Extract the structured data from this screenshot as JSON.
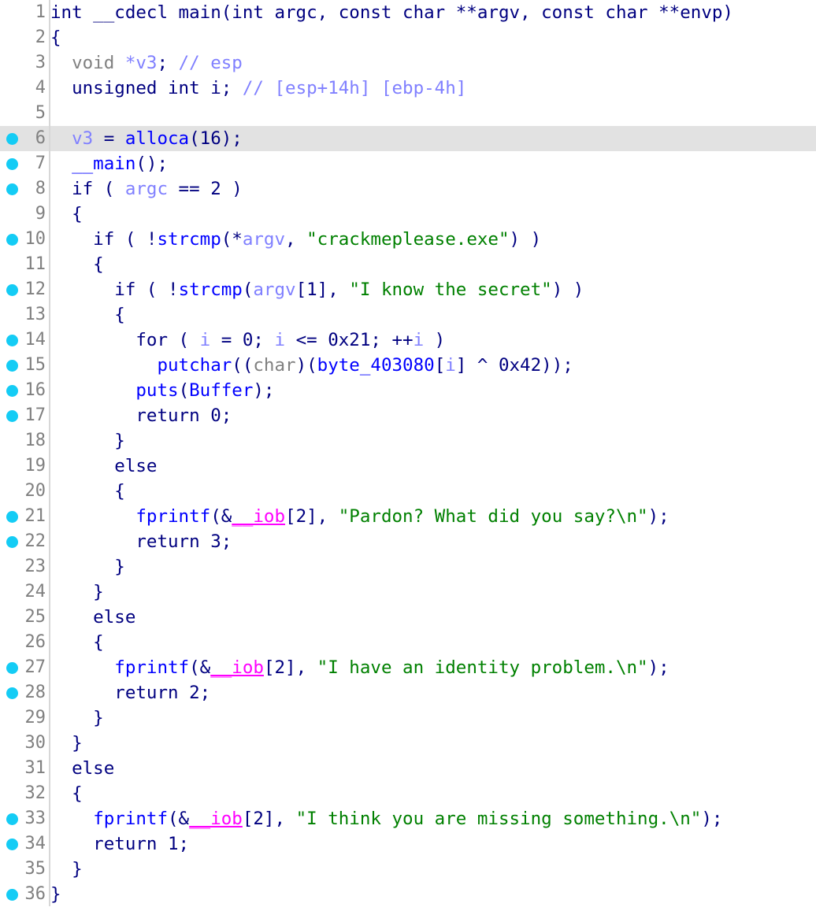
{
  "view": {
    "name": "pseudocode-view",
    "app": "IDA Pro Pseudocode",
    "highlighted_line": 6,
    "colors": {
      "background": "#ffffff",
      "highlight_row": "#e2e2e2",
      "gutter_divider": "#d7d7d7",
      "line_number": "#808080",
      "breakpoint_dot": "#14ccf5",
      "keyword": "#000080",
      "type": "#808080",
      "local_variable": "#8080ff",
      "function": "#0000ff",
      "string": "#008000",
      "comment": "#8080ff",
      "imported_variable": "#ff00ff"
    }
  },
  "lines": [
    {
      "n": "1",
      "bp": false,
      "tokens": [
        {
          "t": "int __cdecl main(int argc, const char **argv, const char **envp)",
          "c": "t-key"
        }
      ]
    },
    {
      "n": "2",
      "bp": false,
      "tokens": [
        {
          "t": "{",
          "c": "t-punct"
        }
      ]
    },
    {
      "n": "3",
      "bp": false,
      "tokens": [
        {
          "t": "  ",
          "c": "t-plain"
        },
        {
          "t": "void",
          "c": "t-type"
        },
        {
          "t": " ",
          "c": "t-plain"
        },
        {
          "t": "*v3",
          "c": "t-lvar"
        },
        {
          "t": "; ",
          "c": "t-punct"
        },
        {
          "t": "// esp",
          "c": "t-cmt"
        }
      ]
    },
    {
      "n": "4",
      "bp": false,
      "tokens": [
        {
          "t": "  unsigned int i",
          "c": "t-key"
        },
        {
          "t": "; ",
          "c": "t-punct"
        },
        {
          "t": "// [esp+14h] [ebp-4h]",
          "c": "t-cmt"
        }
      ]
    },
    {
      "n": "5",
      "bp": false,
      "tokens": []
    },
    {
      "n": "6",
      "bp": true,
      "tokens": [
        {
          "t": "  ",
          "c": "t-plain"
        },
        {
          "t": "v3",
          "c": "t-lvar"
        },
        {
          "t": " = ",
          "c": "t-punct"
        },
        {
          "t": "alloca",
          "c": "t-func"
        },
        {
          "t": "(16);",
          "c": "t-punct"
        }
      ]
    },
    {
      "n": "7",
      "bp": true,
      "tokens": [
        {
          "t": "  ",
          "c": "t-plain"
        },
        {
          "t": "__main",
          "c": "t-func"
        },
        {
          "t": "();",
          "c": "t-punct"
        }
      ]
    },
    {
      "n": "8",
      "bp": true,
      "tokens": [
        {
          "t": "  if ( ",
          "c": "t-key"
        },
        {
          "t": "argc",
          "c": "t-lvar"
        },
        {
          "t": " == 2 )",
          "c": "t-punct"
        }
      ]
    },
    {
      "n": "9",
      "bp": false,
      "tokens": [
        {
          "t": "  {",
          "c": "t-punct"
        }
      ]
    },
    {
      "n": "10",
      "bp": true,
      "tokens": [
        {
          "t": "    if ( !",
          "c": "t-key"
        },
        {
          "t": "strcmp",
          "c": "t-func"
        },
        {
          "t": "(*",
          "c": "t-punct"
        },
        {
          "t": "argv",
          "c": "t-lvar"
        },
        {
          "t": ", ",
          "c": "t-punct"
        },
        {
          "t": "\"crackmeplease.exe\"",
          "c": "t-str"
        },
        {
          "t": ") )",
          "c": "t-punct"
        }
      ]
    },
    {
      "n": "11",
      "bp": false,
      "tokens": [
        {
          "t": "    {",
          "c": "t-punct"
        }
      ]
    },
    {
      "n": "12",
      "bp": true,
      "tokens": [
        {
          "t": "      if ( !",
          "c": "t-key"
        },
        {
          "t": "strcmp",
          "c": "t-func"
        },
        {
          "t": "(",
          "c": "t-punct"
        },
        {
          "t": "argv",
          "c": "t-lvar"
        },
        {
          "t": "[1], ",
          "c": "t-punct"
        },
        {
          "t": "\"I know the secret\"",
          "c": "t-str"
        },
        {
          "t": ") )",
          "c": "t-punct"
        }
      ]
    },
    {
      "n": "13",
      "bp": false,
      "tokens": [
        {
          "t": "      {",
          "c": "t-punct"
        }
      ]
    },
    {
      "n": "14",
      "bp": true,
      "tokens": [
        {
          "t": "        for ( ",
          "c": "t-key"
        },
        {
          "t": "i",
          "c": "t-lvar"
        },
        {
          "t": " = 0; ",
          "c": "t-punct"
        },
        {
          "t": "i",
          "c": "t-lvar"
        },
        {
          "t": " <= 0x21; ++",
          "c": "t-punct"
        },
        {
          "t": "i",
          "c": "t-lvar"
        },
        {
          "t": " )",
          "c": "t-punct"
        }
      ]
    },
    {
      "n": "15",
      "bp": true,
      "tokens": [
        {
          "t": "          ",
          "c": "t-plain"
        },
        {
          "t": "putchar",
          "c": "t-func"
        },
        {
          "t": "((",
          "c": "t-punct"
        },
        {
          "t": "char",
          "c": "t-type"
        },
        {
          "t": ")(",
          "c": "t-punct"
        },
        {
          "t": "byte_403080",
          "c": "t-gvar"
        },
        {
          "t": "[",
          "c": "t-punct"
        },
        {
          "t": "i",
          "c": "t-lvar"
        },
        {
          "t": "] ^ 0x42));",
          "c": "t-punct"
        }
      ]
    },
    {
      "n": "16",
      "bp": true,
      "tokens": [
        {
          "t": "        ",
          "c": "t-plain"
        },
        {
          "t": "puts",
          "c": "t-func"
        },
        {
          "t": "(",
          "c": "t-punct"
        },
        {
          "t": "Buffer",
          "c": "t-gvar"
        },
        {
          "t": ");",
          "c": "t-punct"
        }
      ]
    },
    {
      "n": "17",
      "bp": true,
      "tokens": [
        {
          "t": "        return 0;",
          "c": "t-key"
        }
      ]
    },
    {
      "n": "18",
      "bp": false,
      "tokens": [
        {
          "t": "      }",
          "c": "t-punct"
        }
      ]
    },
    {
      "n": "19",
      "bp": false,
      "tokens": [
        {
          "t": "      else",
          "c": "t-key"
        }
      ]
    },
    {
      "n": "20",
      "bp": false,
      "tokens": [
        {
          "t": "      {",
          "c": "t-punct"
        }
      ]
    },
    {
      "n": "21",
      "bp": true,
      "tokens": [
        {
          "t": "        ",
          "c": "t-plain"
        },
        {
          "t": "fprintf",
          "c": "t-func"
        },
        {
          "t": "(&",
          "c": "t-punct"
        },
        {
          "t": "__iob",
          "c": "t-impvar"
        },
        {
          "t": "[2], ",
          "c": "t-punct"
        },
        {
          "t": "\"Pardon? What did you say?\\n\"",
          "c": "t-str"
        },
        {
          "t": ");",
          "c": "t-punct"
        }
      ]
    },
    {
      "n": "22",
      "bp": true,
      "tokens": [
        {
          "t": "        return 3;",
          "c": "t-key"
        }
      ]
    },
    {
      "n": "23",
      "bp": false,
      "tokens": [
        {
          "t": "      }",
          "c": "t-punct"
        }
      ]
    },
    {
      "n": "24",
      "bp": false,
      "tokens": [
        {
          "t": "    }",
          "c": "t-punct"
        }
      ]
    },
    {
      "n": "25",
      "bp": false,
      "tokens": [
        {
          "t": "    else",
          "c": "t-key"
        }
      ]
    },
    {
      "n": "26",
      "bp": false,
      "tokens": [
        {
          "t": "    {",
          "c": "t-punct"
        }
      ]
    },
    {
      "n": "27",
      "bp": true,
      "tokens": [
        {
          "t": "      ",
          "c": "t-plain"
        },
        {
          "t": "fprintf",
          "c": "t-func"
        },
        {
          "t": "(&",
          "c": "t-punct"
        },
        {
          "t": "__iob",
          "c": "t-impvar"
        },
        {
          "t": "[2], ",
          "c": "t-punct"
        },
        {
          "t": "\"I have an identity problem.\\n\"",
          "c": "t-str"
        },
        {
          "t": ");",
          "c": "t-punct"
        }
      ]
    },
    {
      "n": "28",
      "bp": true,
      "tokens": [
        {
          "t": "      return 2;",
          "c": "t-key"
        }
      ]
    },
    {
      "n": "29",
      "bp": false,
      "tokens": [
        {
          "t": "    }",
          "c": "t-punct"
        }
      ]
    },
    {
      "n": "30",
      "bp": false,
      "tokens": [
        {
          "t": "  }",
          "c": "t-punct"
        }
      ]
    },
    {
      "n": "31",
      "bp": false,
      "tokens": [
        {
          "t": "  else",
          "c": "t-key"
        }
      ]
    },
    {
      "n": "32",
      "bp": false,
      "tokens": [
        {
          "t": "  {",
          "c": "t-punct"
        }
      ]
    },
    {
      "n": "33",
      "bp": true,
      "tokens": [
        {
          "t": "    ",
          "c": "t-plain"
        },
        {
          "t": "fprintf",
          "c": "t-func"
        },
        {
          "t": "(&",
          "c": "t-punct"
        },
        {
          "t": "__iob",
          "c": "t-impvar"
        },
        {
          "t": "[2], ",
          "c": "t-punct"
        },
        {
          "t": "\"I think you are missing something.\\n\"",
          "c": "t-str"
        },
        {
          "t": ");",
          "c": "t-punct"
        }
      ]
    },
    {
      "n": "34",
      "bp": true,
      "tokens": [
        {
          "t": "    return 1;",
          "c": "t-key"
        }
      ]
    },
    {
      "n": "35",
      "bp": false,
      "tokens": [
        {
          "t": "  }",
          "c": "t-punct"
        }
      ]
    },
    {
      "n": "36",
      "bp": true,
      "tokens": [
        {
          "t": "}",
          "c": "t-punct"
        }
      ]
    }
  ]
}
